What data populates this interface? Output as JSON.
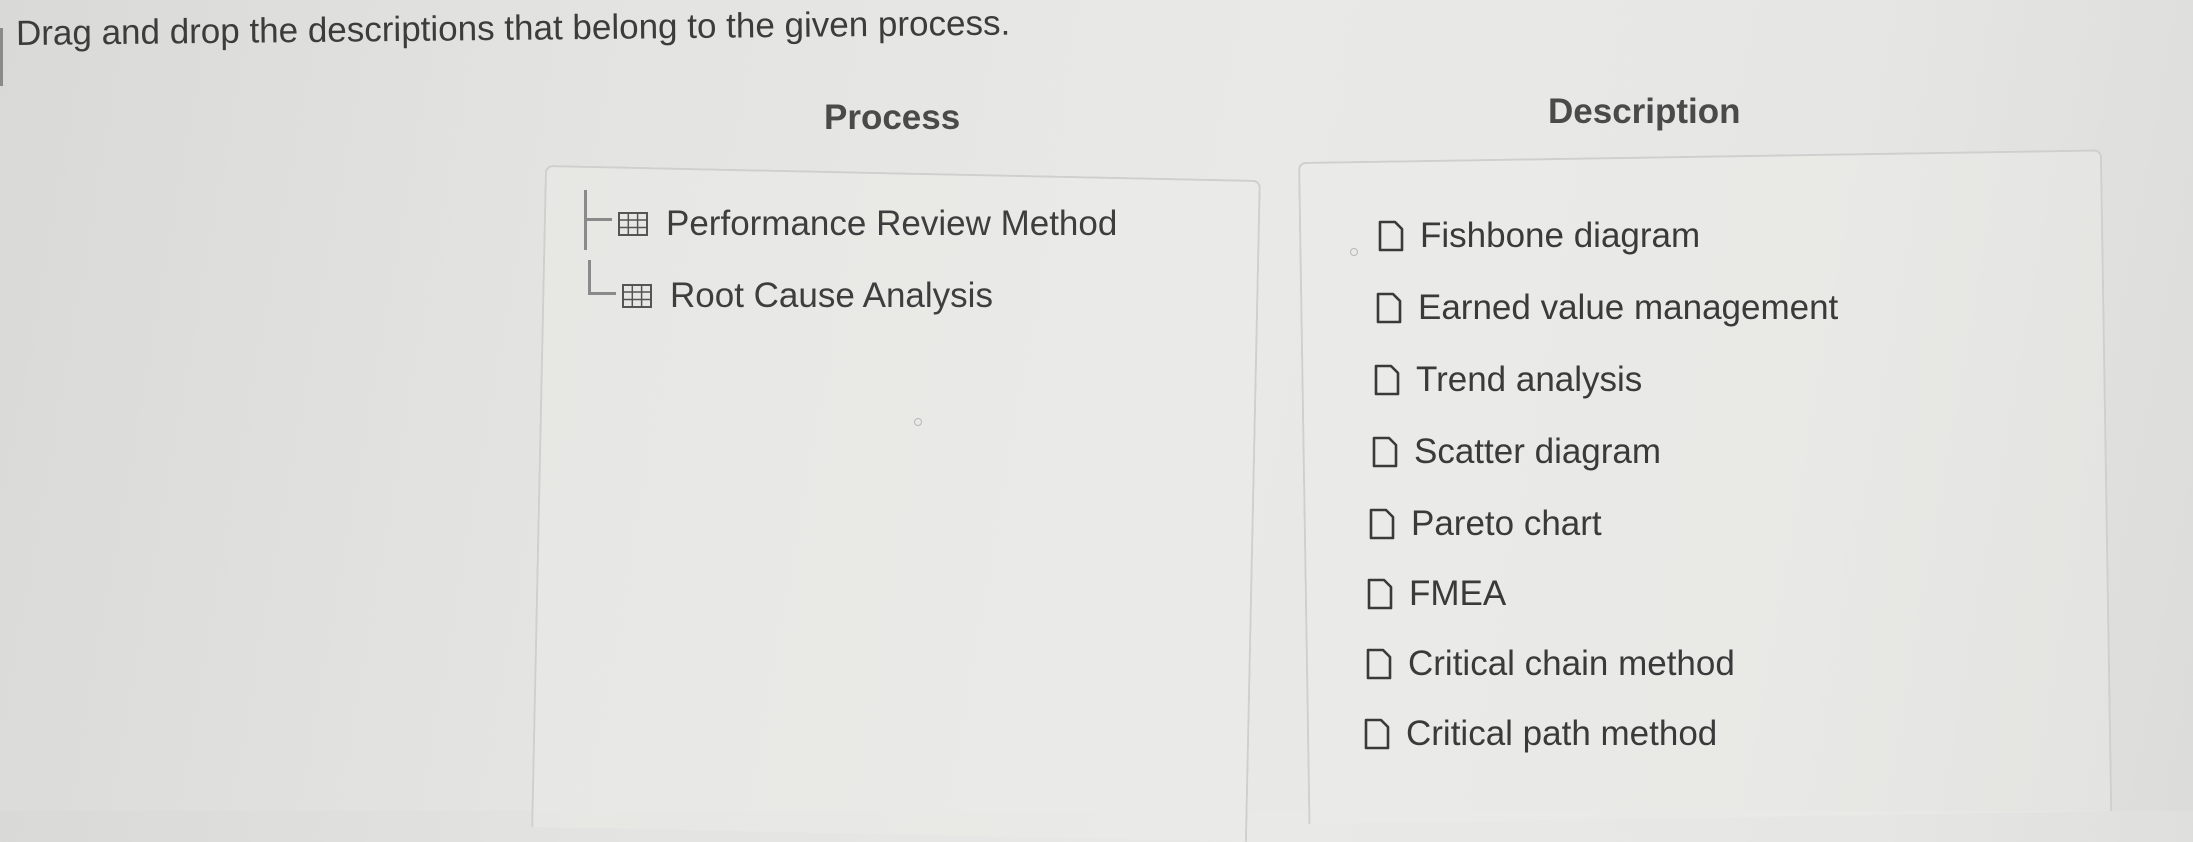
{
  "instruction": "Drag and drop the descriptions that belong to the given process.",
  "process_column": {
    "heading": "Process",
    "items": [
      {
        "label": "Performance Review Method"
      },
      {
        "label": "Root Cause Analysis"
      }
    ]
  },
  "description_column": {
    "heading": "Description",
    "items": [
      {
        "label": "Fishbone diagram"
      },
      {
        "label": "Earned value management"
      },
      {
        "label": "Trend analysis"
      },
      {
        "label": "Scatter diagram"
      },
      {
        "label": "Pareto chart"
      },
      {
        "label": "FMEA"
      },
      {
        "label": "Critical chain method"
      },
      {
        "label": "Critical path method"
      }
    ]
  },
  "icons": {
    "process_item_icon": "table-grid-icon",
    "description_item_icon": "document-icon"
  },
  "colors": {
    "text": "#3a3a3a",
    "border": "#cfcfcd",
    "tree_line": "#8a8a8a"
  }
}
